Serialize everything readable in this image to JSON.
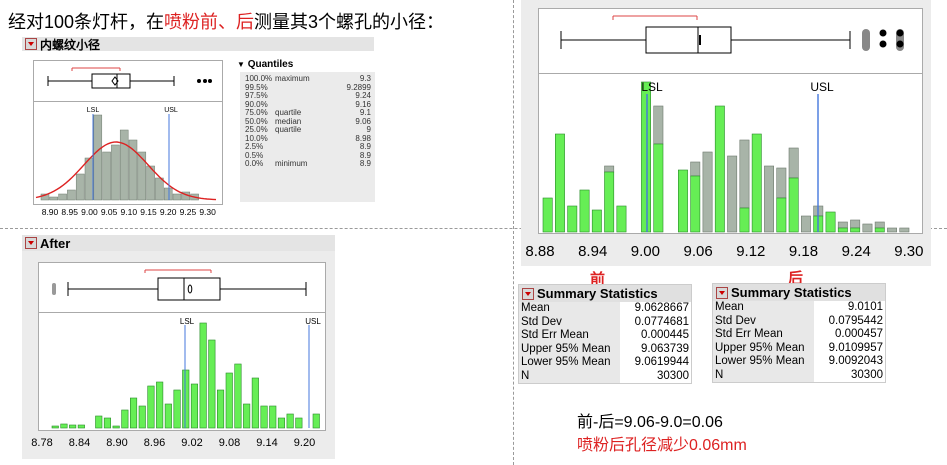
{
  "title": {
    "prefix": "经对100条灯杆，在",
    "highlight": "喷粉前、后",
    "suffix": "测量其3个螺孔的小径："
  },
  "panel1": {
    "header": "内螺纹小径",
    "spec_lsl": "LSL",
    "spec_usl": "USL",
    "axis_ticks": [
      "8.90",
      "8.95",
      "9.00",
      "9.05",
      "9.10",
      "9.15",
      "9.20",
      "9.25",
      "9.30"
    ],
    "quantiles": {
      "header": "Quantiles",
      "rows": [
        {
          "pct": "100.0%",
          "label": "maximum",
          "value": "9.3"
        },
        {
          "pct": "99.5%",
          "label": "",
          "value": "9.2899"
        },
        {
          "pct": "97.5%",
          "label": "",
          "value": "9.24"
        },
        {
          "pct": "90.0%",
          "label": "",
          "value": "9.16"
        },
        {
          "pct": "75.0%",
          "label": "quartile",
          "value": "9.1"
        },
        {
          "pct": "50.0%",
          "label": "median",
          "value": "9.06"
        },
        {
          "pct": "25.0%",
          "label": "quartile",
          "value": "9"
        },
        {
          "pct": "10.0%",
          "label": "",
          "value": "8.98"
        },
        {
          "pct": "2.5%",
          "label": "",
          "value": "8.9"
        },
        {
          "pct": "0.5%",
          "label": "",
          "value": "8.9"
        },
        {
          "pct": "0.0%",
          "label": "minimum",
          "value": "8.9"
        }
      ]
    }
  },
  "panel2": {
    "header": "After",
    "spec_lsl": "LSL",
    "spec_usl": "USL",
    "axis_ticks": [
      "8.78",
      "8.84",
      "8.90",
      "8.96",
      "9.02",
      "9.08",
      "9.14",
      "9.20"
    ]
  },
  "panel3": {
    "spec_lsl": "LSL",
    "spec_usl": "USL",
    "axis_ticks": [
      "8.88",
      "8.94",
      "9.00",
      "9.06",
      "9.12",
      "9.18",
      "9.24",
      "9.30"
    ]
  },
  "before_label": "前",
  "after_label": "后",
  "stats_before": {
    "header": "Summary Statistics",
    "rows": [
      {
        "label": "Mean",
        "value": "9.0628667"
      },
      {
        "label": "Std Dev",
        "value": "0.0774681"
      },
      {
        "label": "Std Err Mean",
        "value": "0.000445"
      },
      {
        "label": "Upper 95% Mean",
        "value": "9.063739"
      },
      {
        "label": "Lower 95% Mean",
        "value": "9.0619944"
      },
      {
        "label": "N",
        "value": "30300"
      }
    ]
  },
  "stats_after": {
    "header": "Summary Statistics",
    "rows": [
      {
        "label": "Mean",
        "value": "9.0101"
      },
      {
        "label": "Std Dev",
        "value": "0.0795442"
      },
      {
        "label": "Std Err Mean",
        "value": "0.000457"
      },
      {
        "label": "Upper 95% Mean",
        "value": "9.0109957"
      },
      {
        "label": "Lower 95% Mean",
        "value": "9.0092043"
      },
      {
        "label": "N",
        "value": "30300"
      }
    ]
  },
  "formula": "前-后=9.06-9.0=0.06",
  "conclusion": "喷粉后孔径减少0.06mm",
  "colors": {
    "green": "#66ee55",
    "gray": "#a8b4a8",
    "red": "#dd2222",
    "blue": "#4477dd",
    "frame": "#aaaaaa"
  }
}
